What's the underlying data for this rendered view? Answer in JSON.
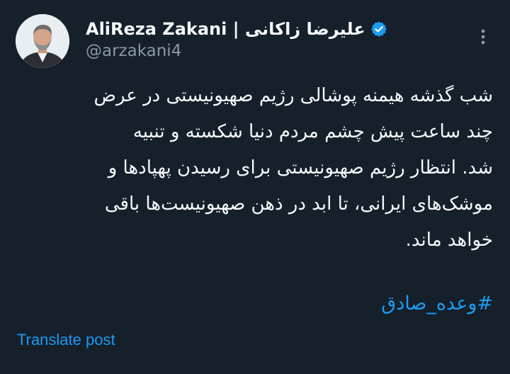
{
  "author": {
    "display_name": "AliReza Zakani | علیرضا زاکانی",
    "handle": "@arzakani4",
    "verified": true,
    "avatar_icon": "profile-photo"
  },
  "post": {
    "text_lines": [
      "شب گذشه هیمنه پوشالی رژیم صهیونیستی در عرض",
      "چند ساعت پیش چشم مردم دنیا شکسته و تنبیه",
      "شد. انتظار رژیم صهیونیستی برای رسیدن پهپادها و",
      "موشک‌های ایرانی، تا ابد در ذهن صهیونیست‌ها باقی",
      "خواهد ماند."
    ],
    "hashtag": "#وعده_صادق"
  },
  "actions": {
    "translate_label": "Translate post",
    "more_icon": "more-vertical-icon"
  },
  "colors": {
    "background": "#15202b",
    "text": "#f7f9f9",
    "muted": "#8b98a5",
    "accent": "#1d9bf0"
  }
}
